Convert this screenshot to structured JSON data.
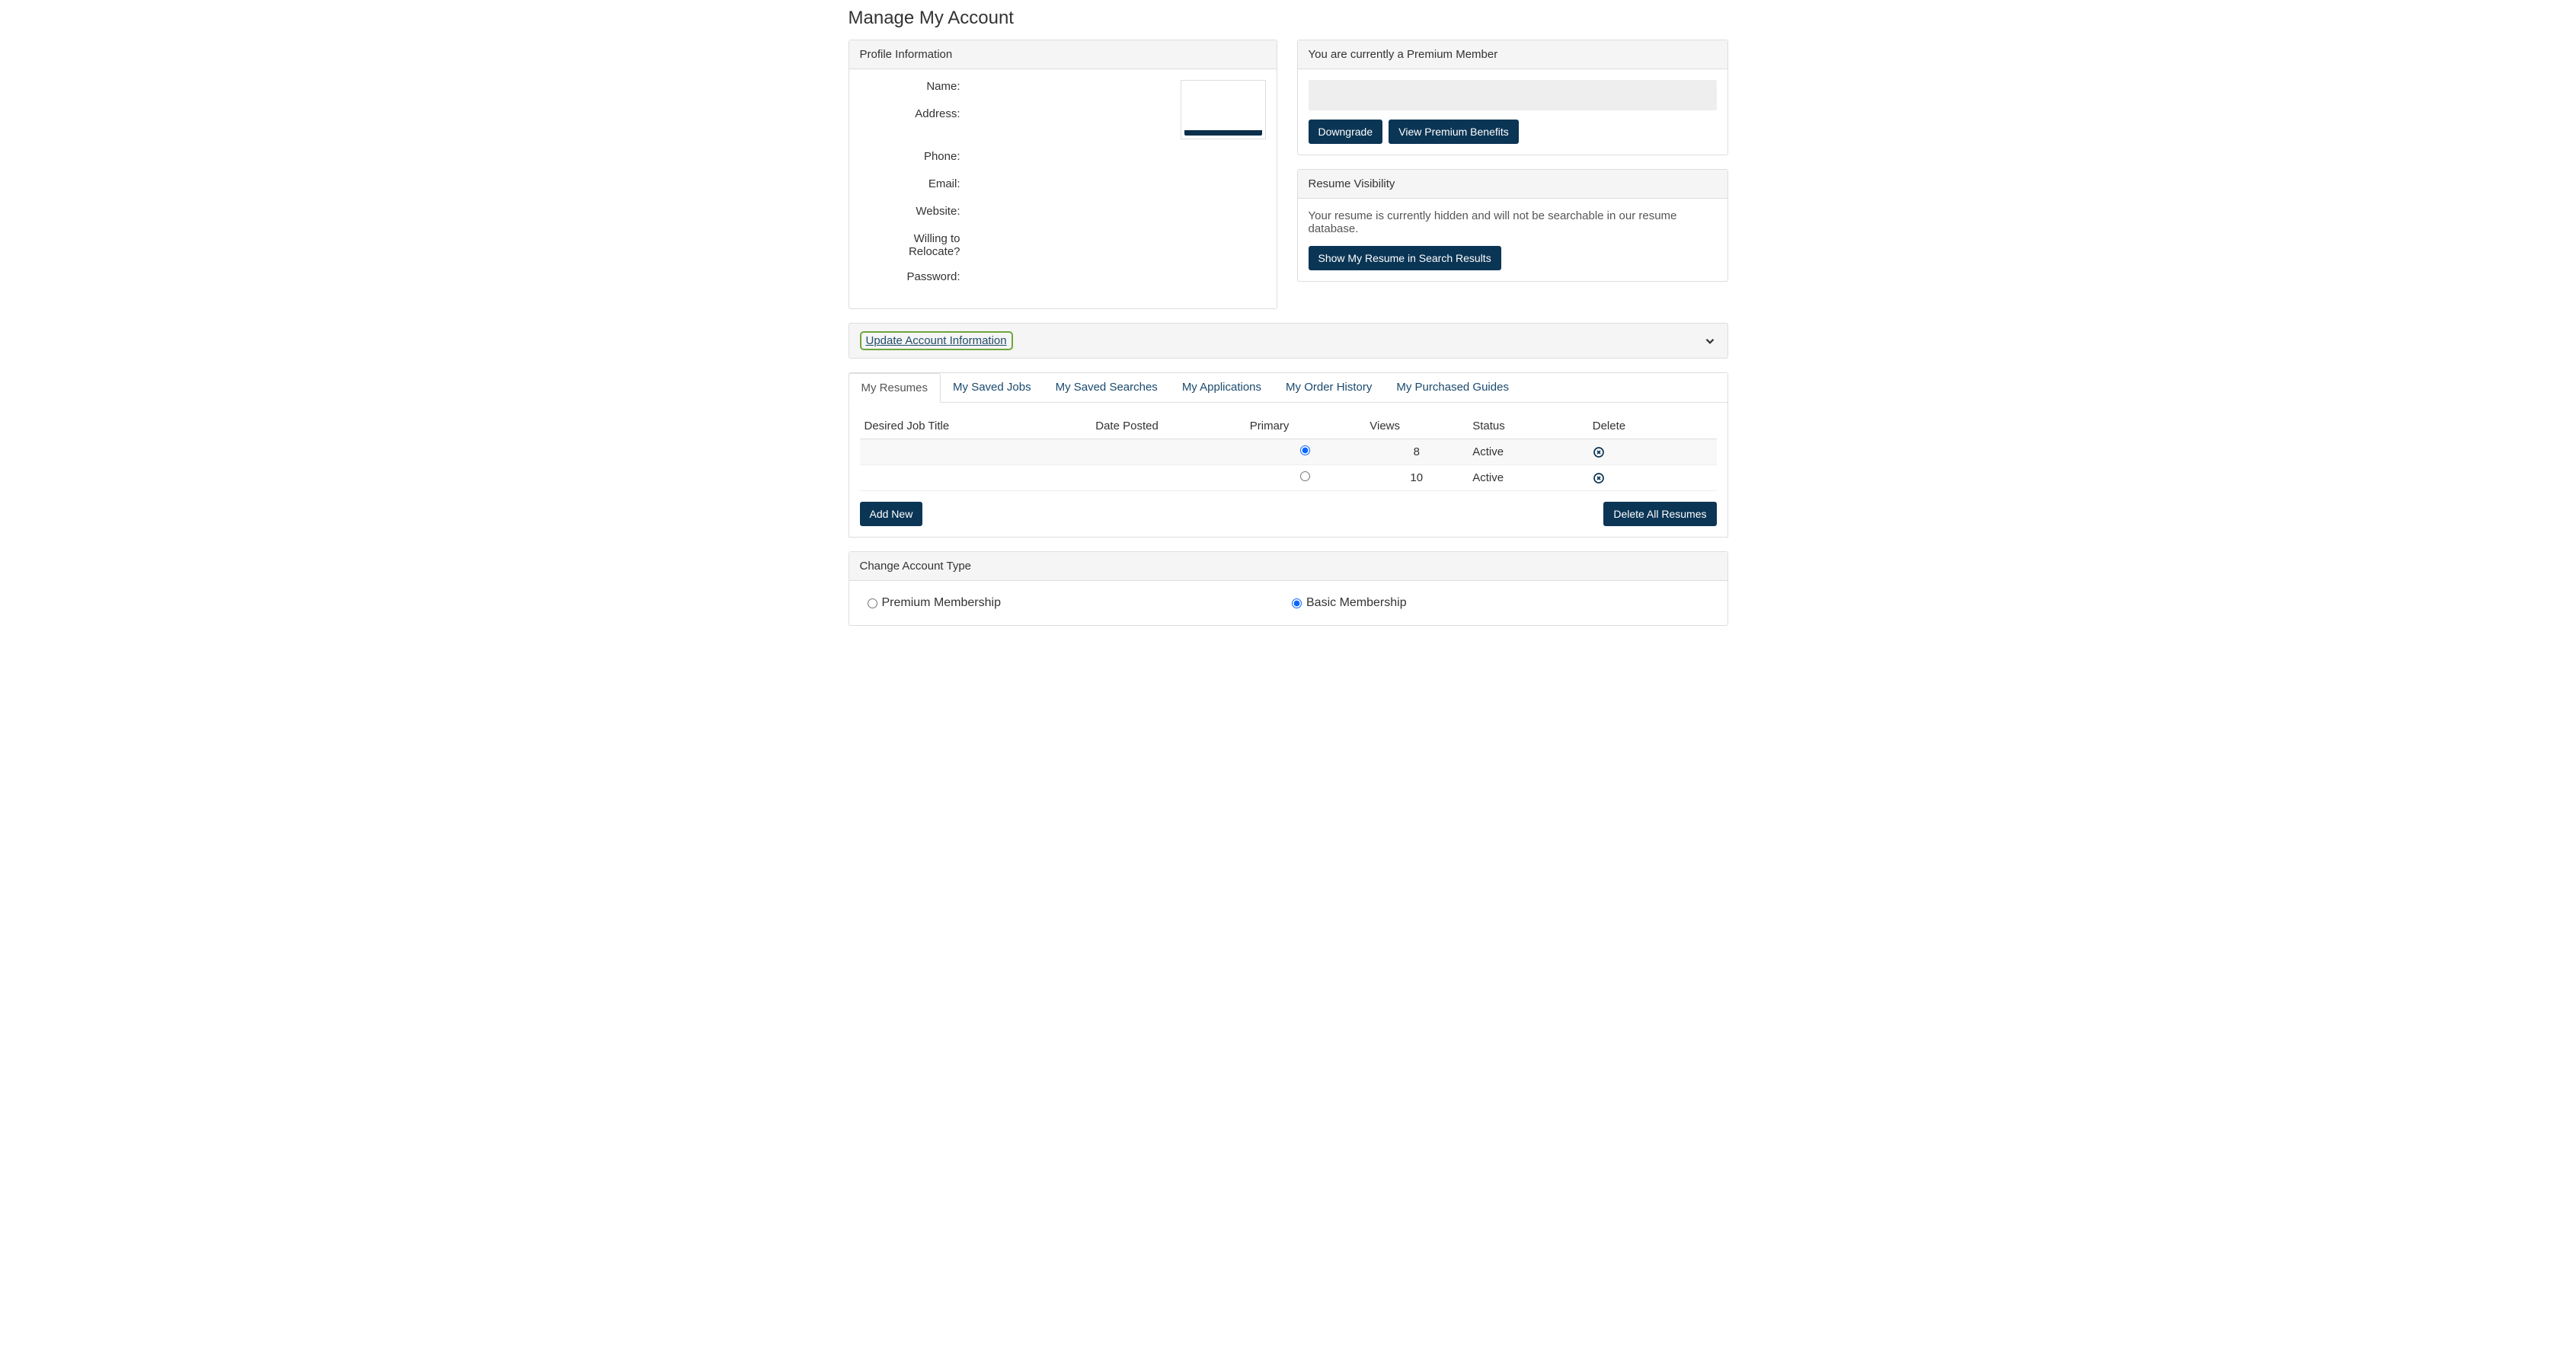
{
  "pageTitle": "Manage My Account",
  "profilePanel": {
    "header": "Profile Information",
    "fields": {
      "name": "Name:",
      "address": "Address:",
      "phone": "Phone:",
      "email": "Email:",
      "website": "Website:",
      "relocate": "Willing to Relocate?",
      "password": "Password:"
    }
  },
  "premiumPanel": {
    "header": "You are currently a Premium Member",
    "downgradeBtn": "Downgrade",
    "viewBenefitsBtn": "View Premium Benefits"
  },
  "resumeVisPanel": {
    "header": "Resume Visibility",
    "text": "Your resume is currently hidden and will not be searchable in our resume database.",
    "showBtn": "Show My Resume in Search Results"
  },
  "accordion": {
    "label": "Update Account Information"
  },
  "tabs": {
    "items": [
      "My Resumes",
      "My Saved Jobs",
      "My Saved Searches",
      "My Applications",
      "My Order History",
      "My Purchased Guides"
    ],
    "table": {
      "headers": {
        "title": "Desired Job Title",
        "date": "Date Posted",
        "primary": "Primary",
        "views": "Views",
        "status": "Status",
        "delete": "Delete"
      },
      "rows": [
        {
          "title": "",
          "date": "",
          "primary": true,
          "views": "8",
          "status": "Active"
        },
        {
          "title": "",
          "date": "",
          "primary": false,
          "views": "10",
          "status": "Active"
        }
      ]
    },
    "addNewBtn": "Add New",
    "deleteAllBtn": "Delete All Resumes"
  },
  "changeAcct": {
    "header": "Change Account Type",
    "premium": "Premium Membership",
    "basic": "Basic Membership"
  }
}
